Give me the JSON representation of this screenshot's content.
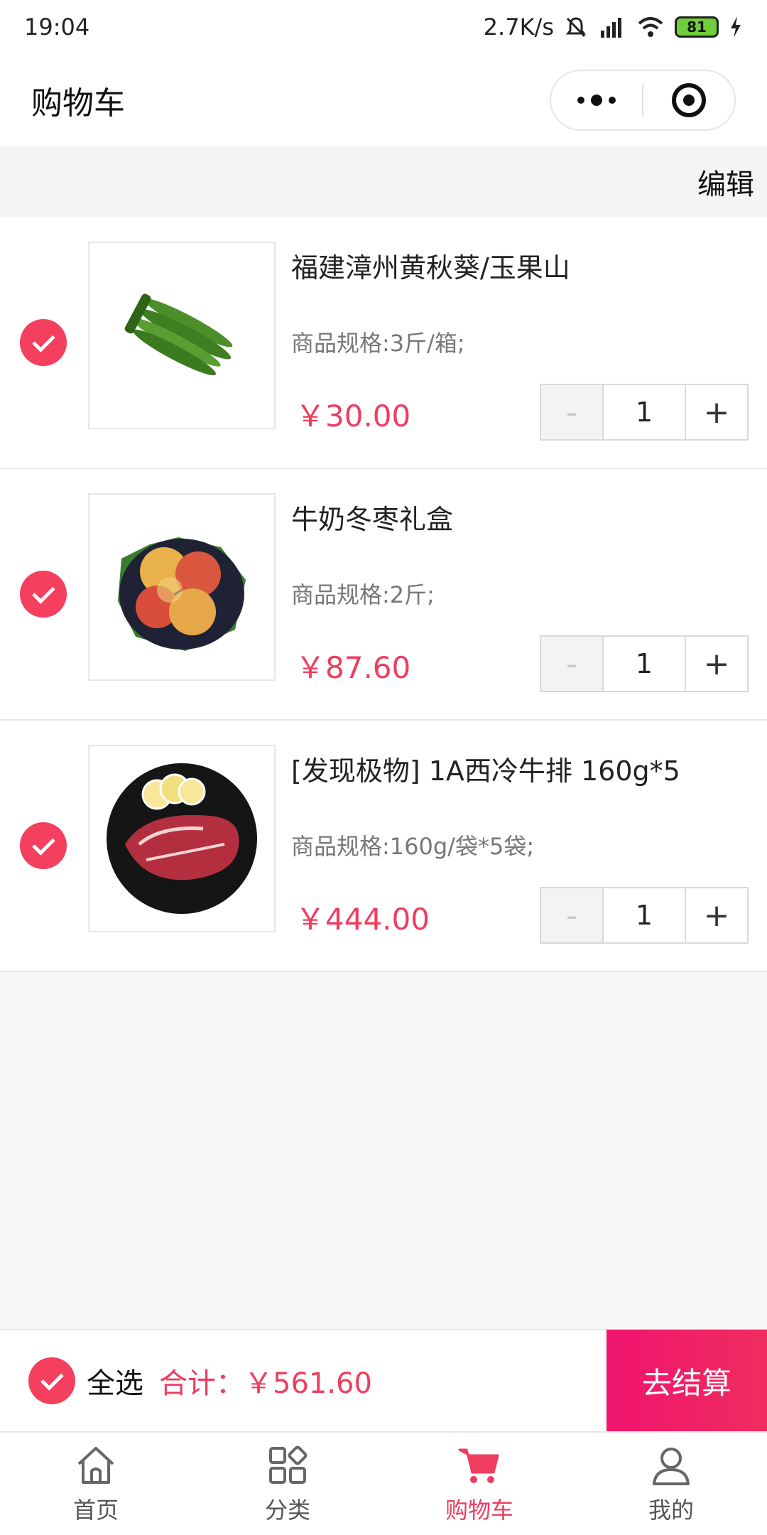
{
  "status_bar": {
    "time": "19:04",
    "net_speed": "2.7K/s",
    "battery": "81"
  },
  "header": {
    "title": "购物车"
  },
  "edit_label": "编辑",
  "items": [
    {
      "name": "福建漳州黄秋葵/玉果山",
      "spec": "商品规格:3斤/箱;",
      "price": "￥30.00",
      "qty": "1",
      "minus": "-",
      "plus": "+",
      "image": "okra-image"
    },
    {
      "name": "牛奶冬枣礼盒",
      "spec": "商品规格:2斤;",
      "price": "￥87.60",
      "qty": "1",
      "minus": "-",
      "plus": "+",
      "image": "jujube-image"
    },
    {
      "name": "[发现极物] 1A西冷牛排 160g*5",
      "spec": "商品规格:160g/袋*5袋;",
      "price": "￥444.00",
      "qty": "1",
      "minus": "-",
      "plus": "+",
      "image": "steak-image"
    }
  ],
  "summary": {
    "select_all": "全选",
    "total": "合计：￥561.60",
    "checkout": "去结算"
  },
  "tabs": [
    {
      "label": "首页",
      "icon": "home-icon"
    },
    {
      "label": "分类",
      "icon": "category-icon"
    },
    {
      "label": "购物车",
      "icon": "cart-icon",
      "active": true
    },
    {
      "label": "我的",
      "icon": "user-icon"
    }
  ],
  "colors": {
    "accent": "#ee3d5f",
    "checkout_bg": "#f0146e"
  }
}
